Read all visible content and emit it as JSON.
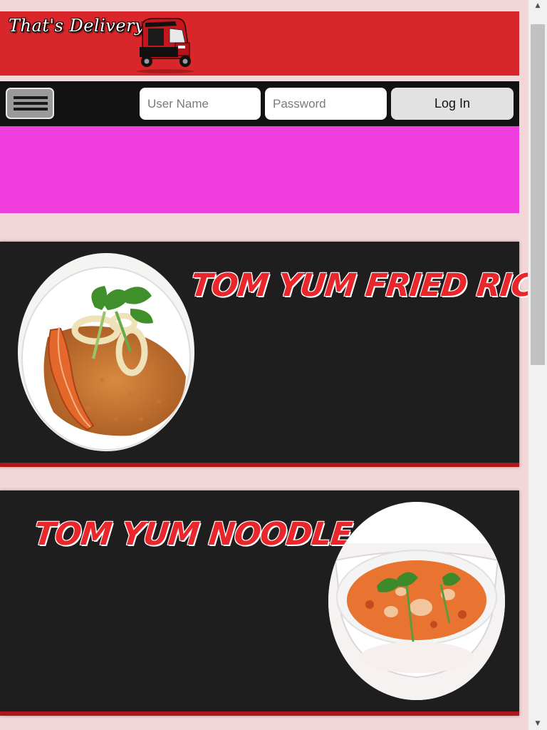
{
  "header": {
    "brand": "That's Delivery",
    "logo_icon": "tuk-tuk-icon"
  },
  "login": {
    "menu_icon": "hamburger-menu-icon",
    "username_placeholder": "User Name",
    "username_value": "",
    "password_placeholder": "Password",
    "password_value": "",
    "login_label": "Log In"
  },
  "banner": {
    "color": "#f03ddd"
  },
  "menu": [
    {
      "title": "TOM YUM FRIED RICE",
      "image_icon": "fried-rice-plate-image"
    },
    {
      "title": "TOM YUM NOODLE",
      "image_icon": "noodle-soup-bowl-image"
    }
  ],
  "colors": {
    "brand_red": "#d9262b",
    "title_red": "#e8262c",
    "card_bg": "#1e1e1e",
    "page_bg": "#f3d6d8"
  }
}
